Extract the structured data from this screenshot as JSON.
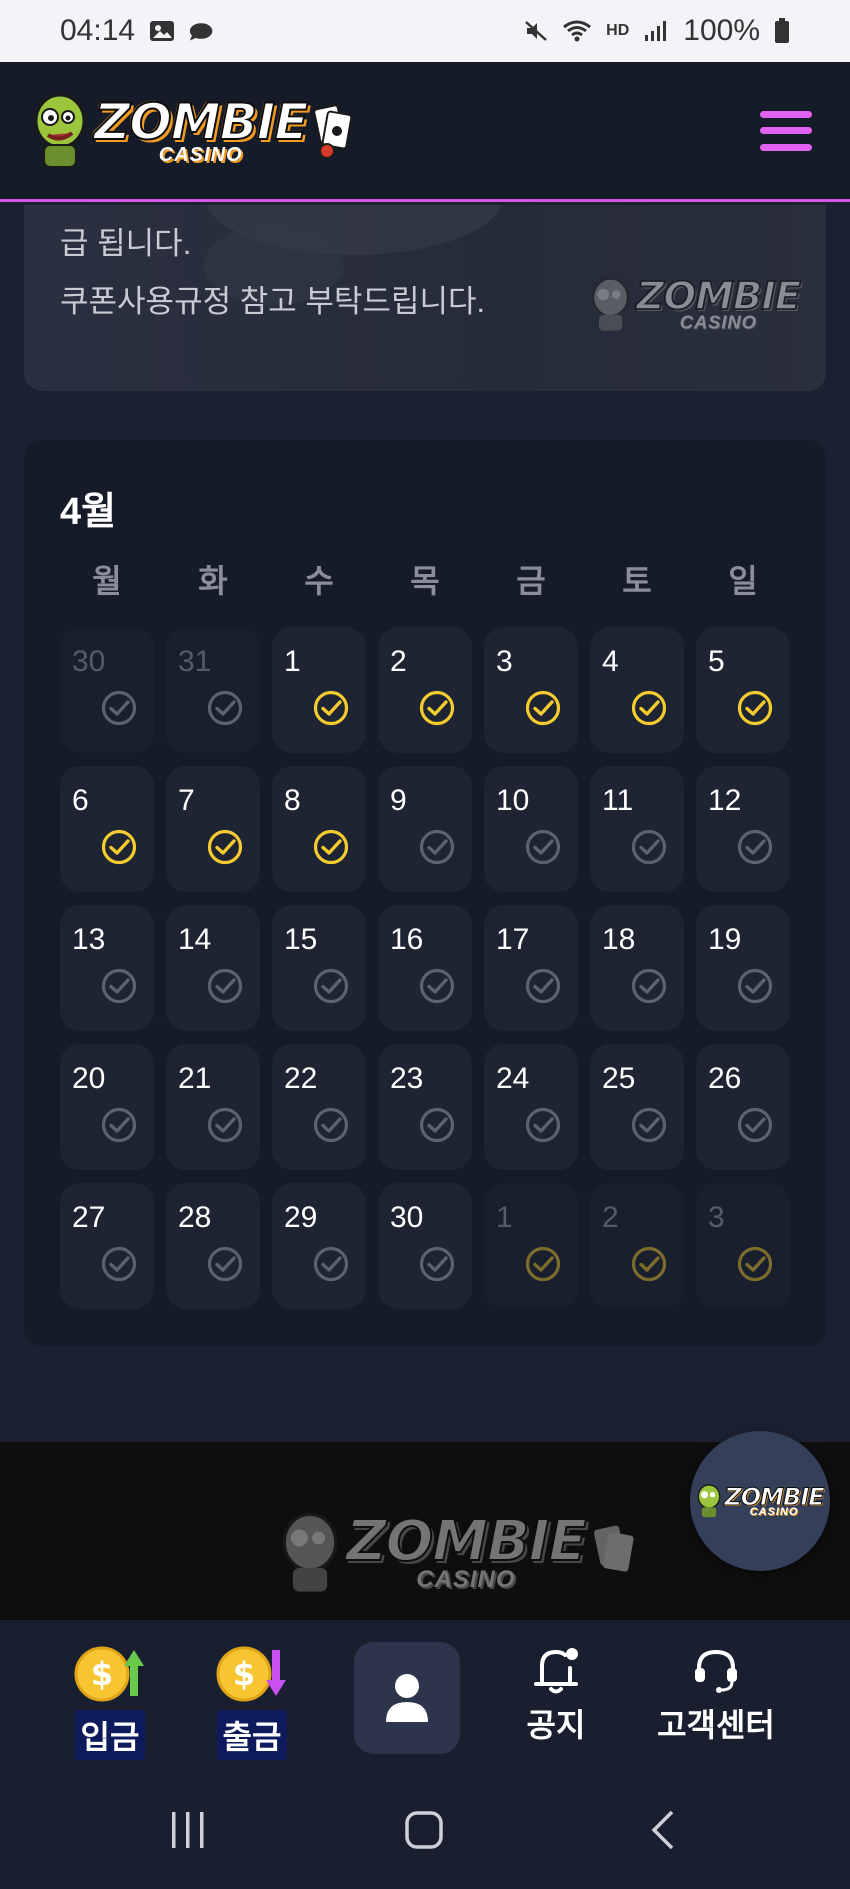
{
  "status_bar": {
    "time": "04:14",
    "battery": "100%",
    "network": "HD"
  },
  "header": {
    "logo_main": "ZOMBIE",
    "logo_sub": "CASINO"
  },
  "banner": {
    "line1": "급 됩니다.",
    "line2": "쿠폰사용규정 참고 부탁드립니다.",
    "logo_main": "ZOMBIE",
    "logo_sub": "CASINO"
  },
  "calendar": {
    "month_label": "4월",
    "weekdays": [
      "월",
      "화",
      "수",
      "목",
      "금",
      "토",
      "일"
    ],
    "weeks": [
      [
        {
          "n": "30",
          "other": true,
          "done": false
        },
        {
          "n": "31",
          "other": true,
          "done": false
        },
        {
          "n": "1",
          "done": true
        },
        {
          "n": "2",
          "done": true
        },
        {
          "n": "3",
          "done": true
        },
        {
          "n": "4",
          "done": true
        },
        {
          "n": "5",
          "done": true
        }
      ],
      [
        {
          "n": "6",
          "done": true
        },
        {
          "n": "7",
          "done": true
        },
        {
          "n": "8",
          "done": true
        },
        {
          "n": "9",
          "done": false
        },
        {
          "n": "10",
          "done": false
        },
        {
          "n": "11",
          "done": false
        },
        {
          "n": "12",
          "done": false
        }
      ],
      [
        {
          "n": "13",
          "done": false
        },
        {
          "n": "14",
          "done": false
        },
        {
          "n": "15",
          "done": false
        },
        {
          "n": "16",
          "done": false
        },
        {
          "n": "17",
          "done": false
        },
        {
          "n": "18",
          "done": false
        },
        {
          "n": "19",
          "done": false
        }
      ],
      [
        {
          "n": "20",
          "done": false
        },
        {
          "n": "21",
          "done": false
        },
        {
          "n": "22",
          "done": false
        },
        {
          "n": "23",
          "done": false
        },
        {
          "n": "24",
          "done": false
        },
        {
          "n": "25",
          "done": false
        },
        {
          "n": "26",
          "done": false
        }
      ],
      [
        {
          "n": "27",
          "done": false
        },
        {
          "n": "28",
          "done": false
        },
        {
          "n": "29",
          "done": false
        },
        {
          "n": "30",
          "done": false
        },
        {
          "n": "1",
          "other": true,
          "done": true
        },
        {
          "n": "2",
          "other": true,
          "done": true
        },
        {
          "n": "3",
          "other": true,
          "done": true
        }
      ]
    ],
    "colors": {
      "checked": "#f5cc2f",
      "unchecked": "#5d6270"
    }
  },
  "footer": {
    "logo_main": "ZOMBIE",
    "logo_sub": "CASINO"
  },
  "fab": {
    "logo_main": "ZOMBIE",
    "logo_sub": "CASINO"
  },
  "bottom_nav": {
    "deposit": "입금",
    "withdraw": "출금",
    "notice": "공지",
    "support": "고객센터"
  },
  "icons": {
    "menu": "hamburger-icon",
    "deposit": "coin-up-icon",
    "withdraw": "coin-down-icon",
    "profile": "user-icon",
    "notice": "bell-icon",
    "support": "headset-icon"
  }
}
